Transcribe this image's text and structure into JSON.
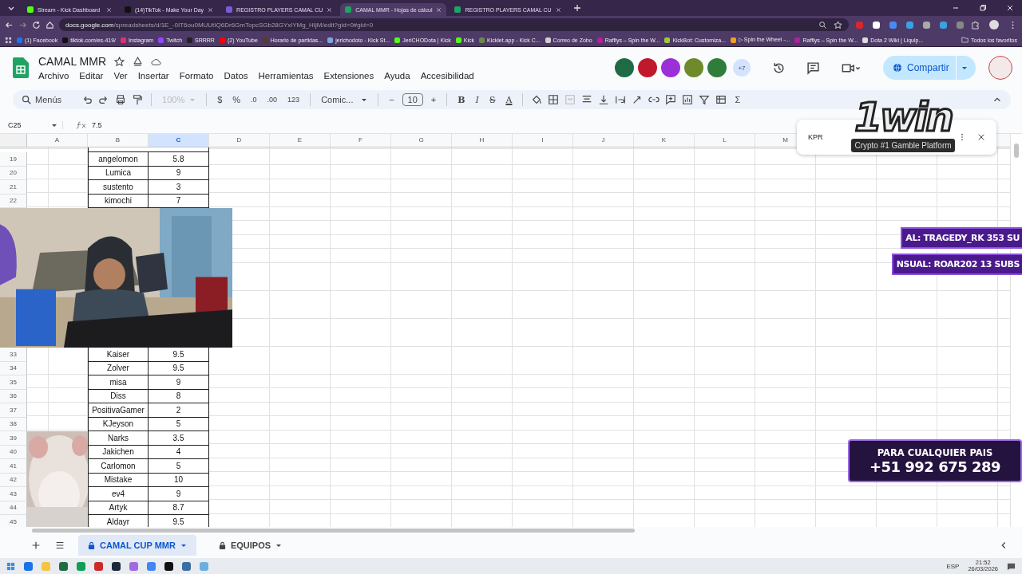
{
  "browser": {
    "tabs": [
      {
        "title": "Stream - Kick Dashboard",
        "kind": "kick",
        "selected": false
      },
      {
        "title": "(14)TikTok - Make Your Day",
        "kind": "tiktok",
        "selected": false
      },
      {
        "title": "REGISTRO PLAYERS CAMAL CU",
        "kind": "form",
        "selected": false
      },
      {
        "title": "CAMAL MMR - Hojas de cálcul",
        "kind": "sheets",
        "selected": true
      },
      {
        "title": "REGISTRO PLAYERS CAMAL CU",
        "kind": "sheets",
        "selected": false
      }
    ],
    "address": {
      "host": "docs.google.com",
      "path": "/spreadsheets/d/1E_-0IT6ou0MUUtIQ6Dr6GmTopcSGb28GYxlYMg_HIjM/edit?gid=0#gid=0"
    },
    "bookmarks": [
      {
        "label": "(1) Facebook",
        "color": "#1877f2"
      },
      {
        "label": "tiktok.com/es-419/",
        "color": "#111111"
      },
      {
        "label": "Instagram",
        "color": "#e1306c"
      },
      {
        "label": "Twitch",
        "color": "#9146ff"
      },
      {
        "label": "SRRRR",
        "color": "#222222"
      },
      {
        "label": "(2) YouTube",
        "color": "#ff0000"
      },
      {
        "label": "Horario de partidas...",
        "color": "#5a3a2a"
      },
      {
        "label": "jerichodoto - Kick St...",
        "color": "#7aa7e0"
      },
      {
        "label": "JeriCHODota | Kick",
        "color": "#53fc18"
      },
      {
        "label": "Kick",
        "color": "#53fc18"
      },
      {
        "label": "Kicklet.app - Kick C...",
        "color": "#6a8a4a"
      },
      {
        "label": "Correo de Zoho",
        "color": "#d0d0d0"
      },
      {
        "label": "Rafflys – Spin the W...",
        "color": "#b0219a"
      },
      {
        "label": "KickBot: Customiza...",
        "color": "#9acd32"
      },
      {
        "label": "▷ Spin the Wheel -...",
        "color": "#f0a020"
      },
      {
        "label": "Rafflys – Spin the W...",
        "color": "#b0219a"
      },
      {
        "label": "Dota 2 Wiki | Liquip...",
        "color": "#dddddd"
      }
    ],
    "all_bookmarks": "Todos los favoritos"
  },
  "sheet": {
    "title": "CAMAL MMR",
    "menu": [
      "Archivo",
      "Editar",
      "Ver",
      "Insertar",
      "Formato",
      "Datos",
      "Herramientas",
      "Extensiones",
      "Ayuda",
      "Accesibilidad"
    ],
    "collaborators": [
      {
        "color": "#1e6b45"
      },
      {
        "color": "#c2182b"
      },
      {
        "color": "#9b30d9"
      },
      {
        "color": "#6f8a2a"
      },
      {
        "color": "#2f7d3a"
      }
    ],
    "more_collaborators": "+7",
    "share": "Compartir"
  },
  "toolbar": {
    "menus": "Menús",
    "zoom": "100%",
    "currency": "$",
    "percent": "%",
    "decrease_decimals": ".0",
    "increase_decimals": ".00",
    "number_format": "123",
    "font": "Comic...",
    "minus": "−",
    "font_size": "10",
    "plus": "+",
    "format_buttons": [
      "B",
      "I",
      "S",
      "A"
    ],
    "sum": "Σ"
  },
  "formula_bar": {
    "cell": "C25",
    "value": "7.5"
  },
  "grid": {
    "columns": [
      {
        "label": "A",
        "selected": false
      },
      {
        "label": "B",
        "selected": false
      },
      {
        "label": "C",
        "selected": true
      },
      {
        "label": "D",
        "selected": false
      },
      {
        "label": "E",
        "selected": false
      },
      {
        "label": "F",
        "selected": false
      },
      {
        "label": "G",
        "selected": false
      },
      {
        "label": "H",
        "selected": false
      },
      {
        "label": "I",
        "selected": false
      },
      {
        "label": "J",
        "selected": false
      },
      {
        "label": "K",
        "selected": false
      },
      {
        "label": "L",
        "selected": false
      },
      {
        "label": "M",
        "selected": false
      }
    ],
    "rows_above_camera": [
      {
        "number": "19",
        "name": "angelomon",
        "mmr": "5.8"
      },
      {
        "number": "20",
        "name": "Lumica",
        "mmr": "9"
      },
      {
        "number": "21",
        "name": "sustento",
        "mmr": "3"
      },
      {
        "number": "22",
        "name": "kimochi",
        "mmr": "7"
      }
    ],
    "rows_below_camera": [
      {
        "number": "33",
        "name": "Kaiser",
        "mmr": "9.5"
      },
      {
        "number": "34",
        "name": "Zolver",
        "mmr": "9.5"
      },
      {
        "number": "35",
        "name": "misa",
        "mmr": "9"
      },
      {
        "number": "36",
        "name": "Diss",
        "mmr": "8"
      },
      {
        "number": "37",
        "name": "PositivaGamer",
        "mmr": "2"
      },
      {
        "number": "38",
        "name": "KJeyson",
        "mmr": "5"
      },
      {
        "number": "39",
        "name": "Narks",
        "mmr": "3.5"
      },
      {
        "number": "40",
        "name": "Jakichen",
        "mmr": "4"
      },
      {
        "number": "41",
        "name": "Carlomon",
        "mmr": "5"
      },
      {
        "number": "42",
        "name": "Mistake",
        "mmr": "10"
      },
      {
        "number": "43",
        "name": "ev4",
        "mmr": "9"
      },
      {
        "number": "44",
        "name": "Artyk",
        "mmr": "8.7"
      },
      {
        "number": "45",
        "name": "Aldayr",
        "mmr": "9.5"
      }
    ]
  },
  "find": {
    "value": "KPR"
  },
  "sheet_tabs": [
    {
      "label": "CAMAL CUP MMR",
      "selected": true
    },
    {
      "label": "EQUIPOS",
      "selected": false
    }
  ],
  "overlays": {
    "ad_logo": "1win",
    "ad_tagline": "Crypto #1 Gamble Platform",
    "tickers": [
      "AL: TRAGEDY_RK 353 SU",
      "NSUAL: ROAR202 13 SUBS"
    ],
    "promo_title": "PARA CUALQUIER PAIS",
    "promo_phone": "+51 992 675 289"
  },
  "taskbar": {
    "language": "ESP",
    "time": "21:52",
    "date": "26/03/2026"
  }
}
